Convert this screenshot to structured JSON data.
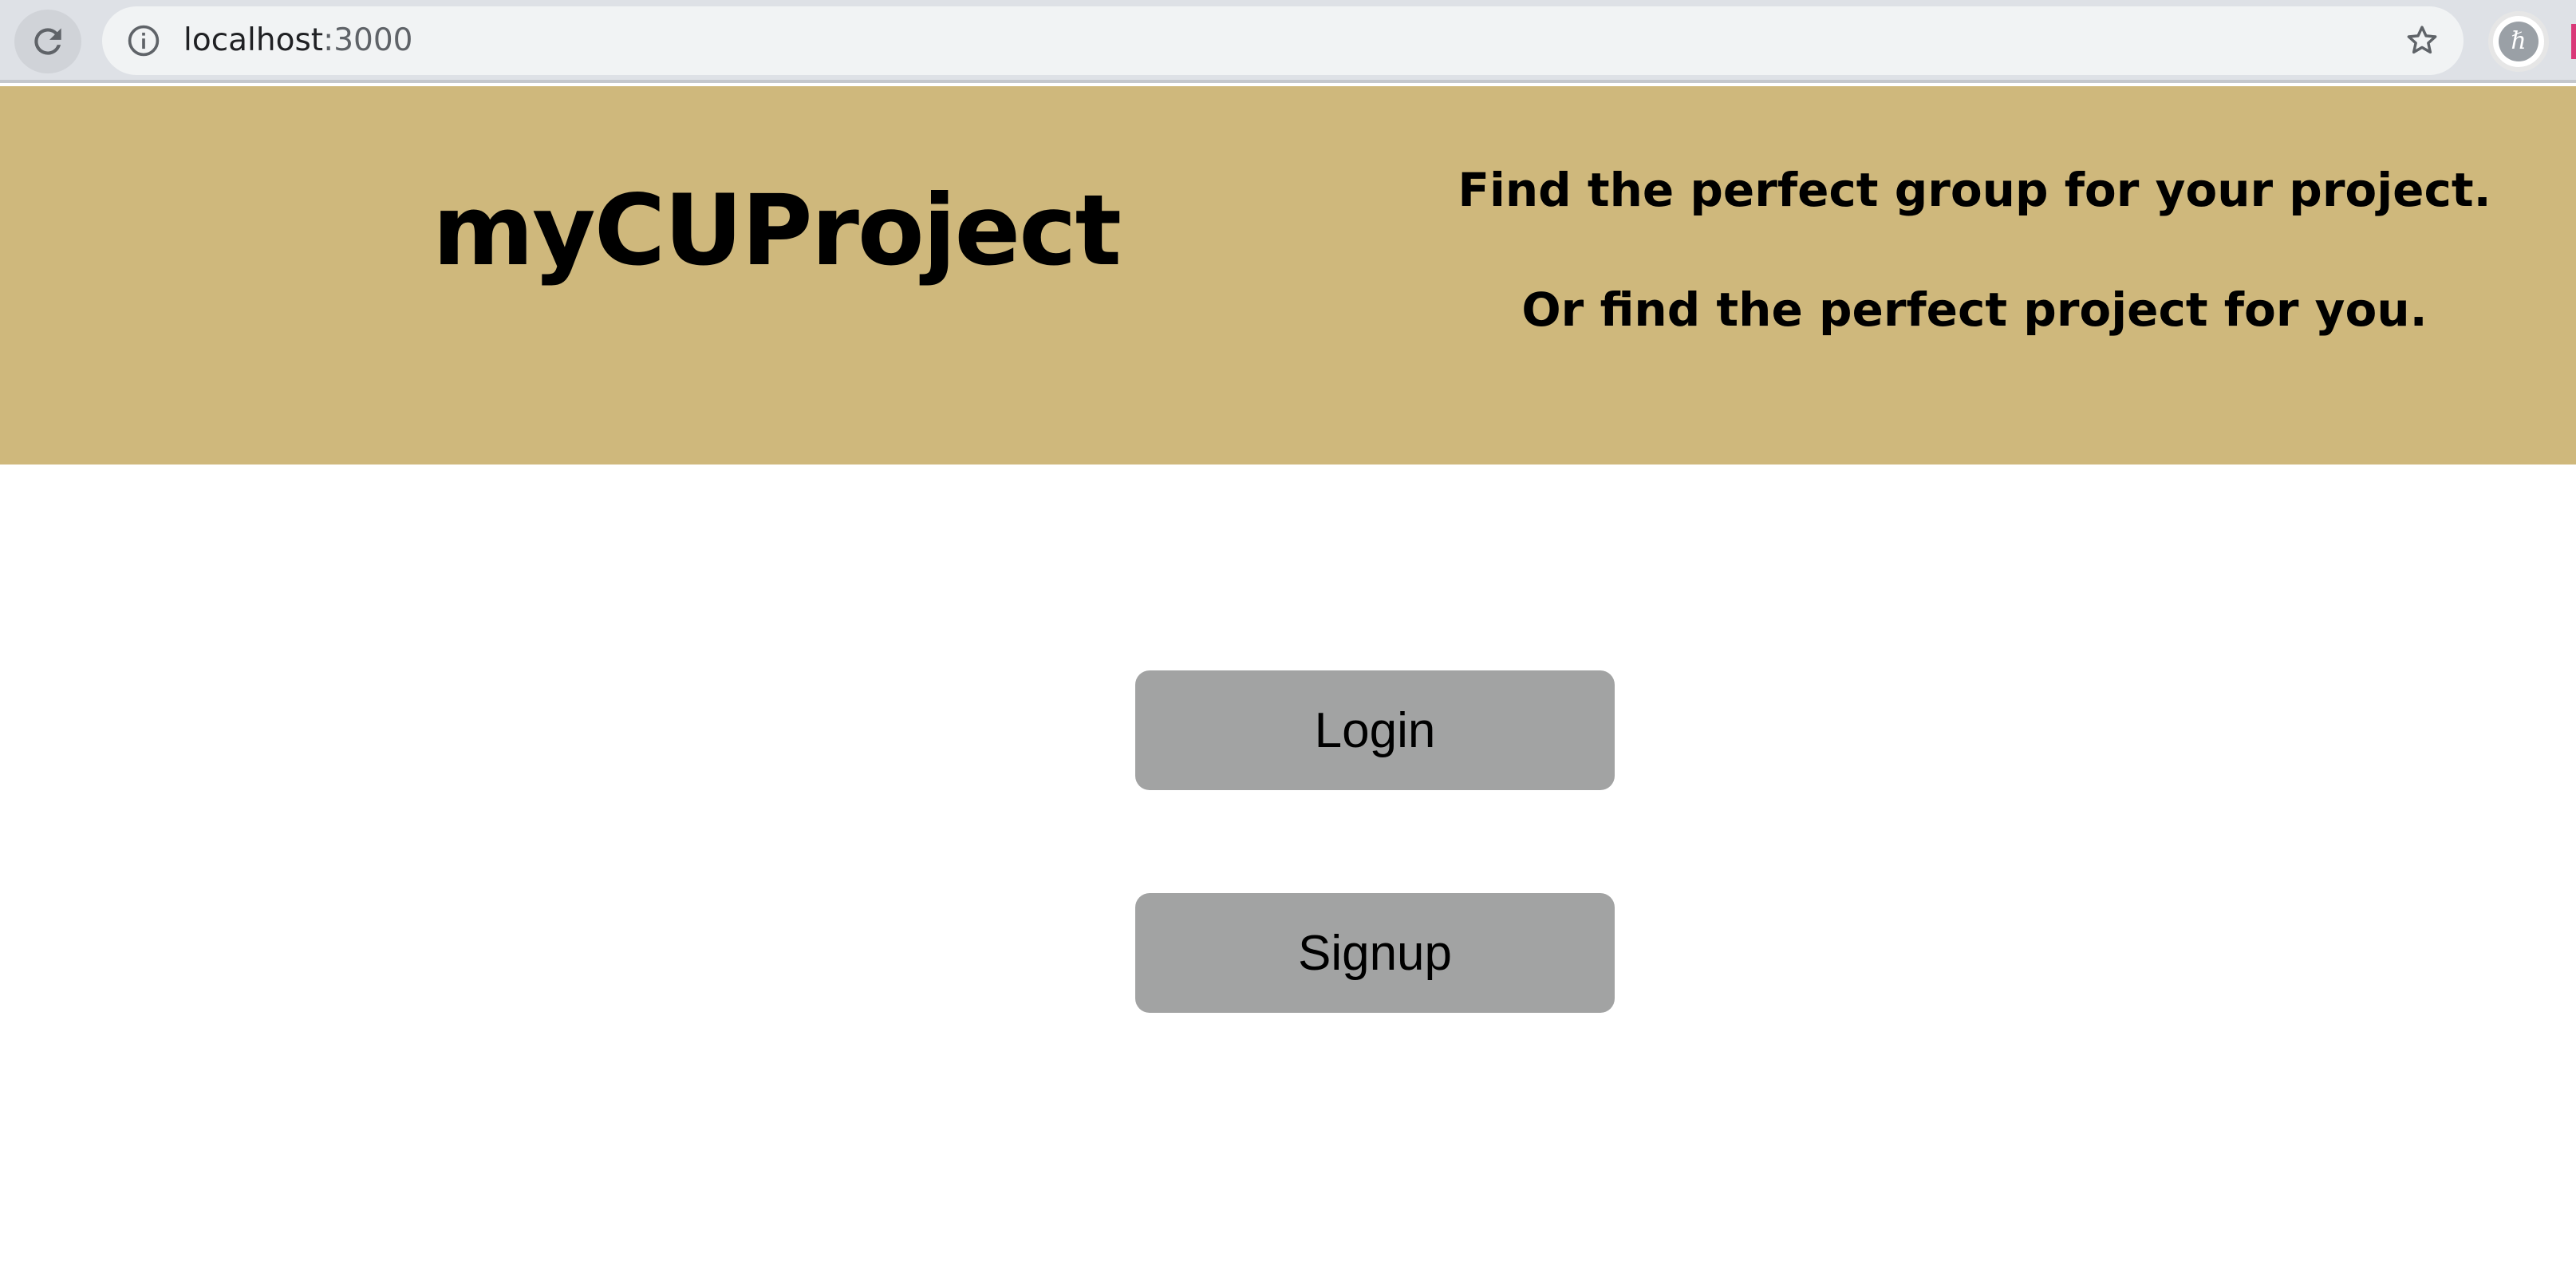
{
  "browser": {
    "url_host": "localhost",
    "url_port": ":3000",
    "icons": {
      "reload": "reload-icon",
      "info": "info-icon",
      "star": "star-icon",
      "profile": "profile-avatar"
    },
    "profile_initial": "ℏ"
  },
  "header": {
    "title": "myCUProject",
    "tagline_1": "Find the perfect group for your project.",
    "tagline_2": "Or find the perfect project for you.",
    "background_color": "#cfb87c"
  },
  "main": {
    "login_label": "Login",
    "signup_label": "Signup",
    "button_color": "#a2a3a3"
  }
}
